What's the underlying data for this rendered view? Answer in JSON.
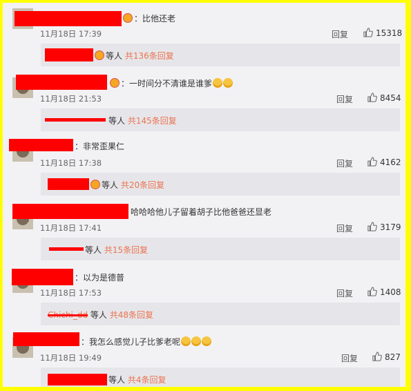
{
  "comments": [
    {
      "text": "：比他还老",
      "time": "11月18日 17:39",
      "reply": "回复",
      "likes": "15318",
      "sub": {
        "suffix": "等人",
        "more": "共136条回复"
      }
    },
    {
      "text": "：一时间分不清谁是谁爹",
      "time": "11月18日 21:53",
      "reply": "回复",
      "likes": "8454",
      "sub": {
        "user": "",
        "suffix": "等人",
        "more": "共145条回复"
      }
    },
    {
      "text": "：非常歪果仁",
      "time": "11月18日 17:38",
      "reply": "回复",
      "likes": "4162",
      "sub": {
        "suffix": "等人",
        "more": "共20条回复"
      }
    },
    {
      "text": "哈哈哈他儿子留着胡子比他爸爸还显老",
      "time": "11月18日 17:41",
      "reply": "回复",
      "likes": "3179",
      "sub": {
        "user": "",
        "suffix": "等人",
        "more": "共15条回复"
      }
    },
    {
      "text": "：以为是德普",
      "time": "11月18日 17:53",
      "reply": "回复",
      "likes": "1408",
      "sub": {
        "user": "Chichi_dd",
        "suffix": "等人",
        "more": "共48条回复"
      }
    },
    {
      "text": "：我怎么感觉儿子比爹老呢",
      "time": "11月18日 19:49",
      "reply": "回复",
      "likes": "827",
      "sub": {
        "suffix": "等人",
        "more": "共4条回复"
      }
    }
  ],
  "colors": {
    "border": "#ffff00",
    "redaction": "#ff0000",
    "link": "#eb7350"
  },
  "icons": {
    "like": "thumbs-up-icon",
    "emoji": "face-emoji-icon",
    "badge": "vip-badge-icon"
  }
}
